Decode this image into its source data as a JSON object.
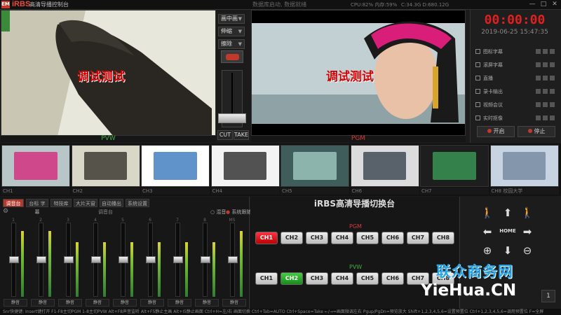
{
  "app": {
    "logo_badge": "EM",
    "logo_text": "iRBS",
    "title": "高清导播控制台",
    "top_message": "数据库启动, 数据就绪",
    "cpu": "CPU:82% 内存:59%",
    "disk": "C:34.3G D:680.12G",
    "win_buttons": [
      "—",
      "□",
      "✕"
    ]
  },
  "preview": {
    "pvw_overlay": "调试测试",
    "pgm_overlay": "调试测试",
    "pvw_label": "PVW",
    "pgm_label": "PGM"
  },
  "controls": {
    "dropdowns": [
      "画中画",
      "伸缩",
      "擦除"
    ],
    "cut": "CUT",
    "take": "TAKE"
  },
  "right_panel": {
    "clock": "00:00:00",
    "datetime": "2019-06-25 15:47:35",
    "features": [
      "图标字幕",
      "滚屏字幕",
      "直播",
      "录卡输出",
      "视频会议",
      "实时抠像"
    ],
    "start": "开启",
    "stop": "停止"
  },
  "thumbnails": [
    "CH1",
    "CH2",
    "CH3",
    "CH4",
    "CH5",
    "CH6",
    "CH7",
    "CH8 校园大学"
  ],
  "audio": {
    "tabs": [
      "调音台",
      "台标 字幕",
      "特技库",
      "大片天窗",
      "自动播出",
      "系统设置"
    ],
    "panel_title": "调音台",
    "radio_1": "混音",
    "radio_2": "系统跟随",
    "channels": [
      "1",
      "2",
      "3",
      "4",
      "5",
      "6",
      "7",
      "8",
      "MS"
    ],
    "mute": "静音"
  },
  "switcher": {
    "title": "iRBS高清导播切换台",
    "pgm_label": "PGM",
    "pvw_label": "PVW",
    "pgm_buttons": [
      "CH1",
      "CH2",
      "CH3",
      "CH4",
      "CH5",
      "CH6",
      "CH7",
      "CH8"
    ],
    "pvw_buttons": [
      "CH1",
      "CH2",
      "CH3",
      "CH4",
      "CH5",
      "CH6",
      "CH7",
      "CH8"
    ],
    "pgm_active": "CH1",
    "pvw_active": "CH2"
  },
  "ptz": {
    "home": "HOME",
    "icons": [
      "walk-left-icon",
      "arrow-up-icon",
      "walk-right-icon",
      "arrow-left-icon",
      "arrow-right-icon",
      "zoom-in-icon",
      "arrow-down-icon",
      "zoom-out-icon"
    ]
  },
  "watermark": {
    "line1": "联众商务网",
    "line2": "YieHua.CN"
  },
  "bottom_hint": "Snr快捷键: Insert键打开 F1-F8主切PGM  1-8主切PVW  Alt+F8声音监听  Alt+F5静止主画 Alt+I5静止画面  Ctrl+H=左/右 画面切换  Ctrl+Tab=AUTO Ctrl+Space=Take  ←/→=画面微调左右  Pgup/PgDn=预览放大  Shift+1,2,3,4,5,6=设置预置位  Ctrl+1,2,3,4,5,6=调用预置位  F=全屏",
  "small_btn": "1"
}
